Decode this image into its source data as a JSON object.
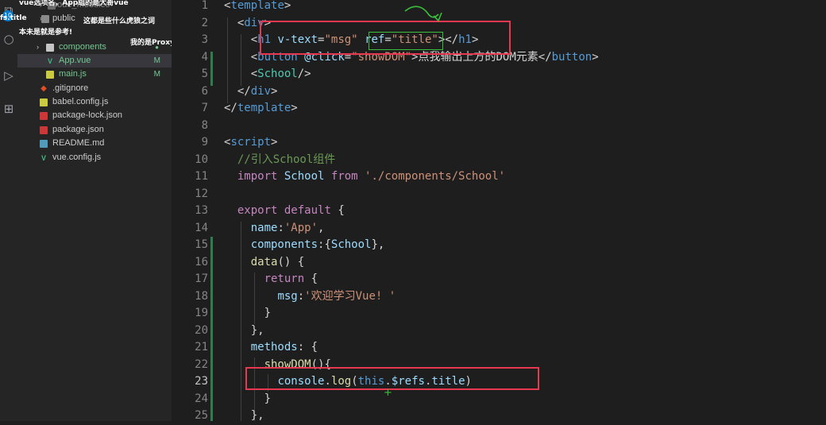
{
  "activity_bar": {
    "badge_count": "10",
    "icons": [
      "files-icon",
      "search-icon",
      "run-debug-icon",
      "extensions-icon"
    ]
  },
  "sidebar": {
    "items": [
      {
        "name": "node_modules",
        "type": "folder",
        "status": ""
      },
      {
        "name": "public",
        "type": "folder",
        "status": ""
      },
      {
        "name": "components",
        "type": "folder",
        "status": "dot"
      },
      {
        "name": "App.vue",
        "type": "vue",
        "status": "M"
      },
      {
        "name": "main.js",
        "type": "js",
        "status": "M"
      },
      {
        "name": ".gitignore",
        "type": "git",
        "status": ""
      },
      {
        "name": "babel.config.js",
        "type": "babel",
        "status": ""
      },
      {
        "name": "package-lock.json",
        "type": "npm",
        "status": ""
      },
      {
        "name": "package.json",
        "type": "npm",
        "status": ""
      },
      {
        "name": "README.md",
        "type": "md",
        "status": ""
      },
      {
        "name": "vue.config.js",
        "type": "vue",
        "status": ""
      }
    ],
    "overlay": {
      "line1": "vue选项名，App组的是大哥vue",
      "line2": "这都是些什么虎狼之词",
      "line3": "本未是就是参考!",
      "line4": "我的是Proxy",
      "line5": "fs.title"
    }
  },
  "editor": {
    "current_line": "23",
    "line_numbers": [
      "1",
      "2",
      "3",
      "4",
      "5",
      "6",
      "7",
      "8",
      "9",
      "10",
      "11",
      "12",
      "13",
      "14",
      "15",
      "16",
      "17",
      "18",
      "19",
      "20",
      "21",
      "22",
      "23",
      "24",
      "25"
    ],
    "code": {
      "l1": {
        "open": "<",
        "tag": "template",
        "close": ">"
      },
      "l2": {
        "open": "<",
        "tag": "div",
        "close": ">"
      },
      "l3": {
        "open": "<",
        "tag": "h1",
        "attr1": "v-text",
        "eq1": "=",
        "val1": "\"msg\"",
        "attr2": "ref",
        "eq2": "=",
        "val2": "\"title\"",
        "mid": "></",
        "tag2": "h1",
        "close": ">"
      },
      "l4": {
        "open": "<",
        "tag": "button",
        "attr1": "@click",
        "eq1": "=",
        "val1": "\"showDOM\"",
        "text": ">点我输出上方的DOM元素</",
        "tag2": "button",
        "close": ">"
      },
      "l5": {
        "open": "<",
        "comp": "School",
        "close": "/>"
      },
      "l6": {
        "open": "</",
        "tag": "div",
        "close": ">"
      },
      "l7": {
        "open": "</",
        "tag": "template",
        "close": ">"
      },
      "l9": {
        "open": "<",
        "tag": "script",
        "close": ">"
      },
      "l10": {
        "comment": "//引入School组件"
      },
      "l11": {
        "kw": "import",
        "ident": "School",
        "kw2": "from",
        "str": "'./components/School'"
      },
      "l13": {
        "kw": "export",
        "kw2": "default",
        "brace": "{"
      },
      "l14": {
        "key": "name",
        "colon": ":",
        "str": "'App'",
        "comma": ","
      },
      "l15": {
        "key": "components",
        "colon": ":",
        "open": "{",
        "comp": "School",
        "close": "},"
      },
      "l16": {
        "fn": "data",
        "rest": "() {"
      },
      "l17": {
        "kw": "return",
        "brace": "{"
      },
      "l18": {
        "key": "msg",
        "colon": ":",
        "str": "'欢迎学习Vue! '"
      },
      "l19": {
        "brace": "}"
      },
      "l20": {
        "brace": "},"
      },
      "l21": {
        "key": "methods",
        "colon": ":",
        "brace": "{"
      },
      "l22": {
        "fn": "showDOM",
        "rest": "(){"
      },
      "l23": {
        "obj": "console",
        "dot": ".",
        "fn": "log",
        "open": "(",
        "kw": "this",
        "dot2": ".",
        "var": "$refs",
        "dot3": ".",
        "prop": "title",
        "close": ")"
      },
      "l24": {
        "brace": "}"
      },
      "l25": {
        "brace": "},"
      }
    }
  },
  "colors": {
    "background": "#1e1e1e",
    "sidebar": "#252526",
    "highlight_red": "#e8384f",
    "highlight_green": "#3bbf3b",
    "tag": "#569cd6",
    "attribute": "#9cdcfe",
    "string": "#ce9178"
  }
}
